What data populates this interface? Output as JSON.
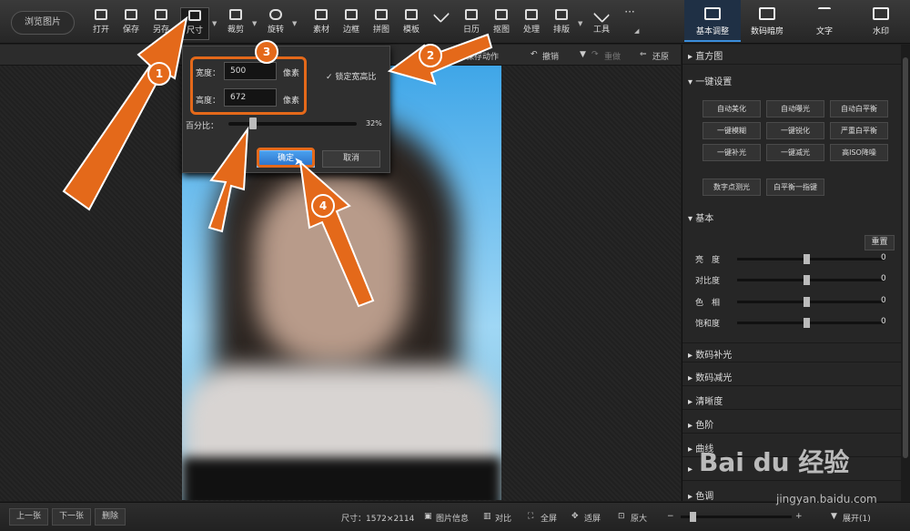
{
  "toolbar": {
    "browse_label": "浏览图片",
    "tools": [
      {
        "label": "打开",
        "icon": "open-icon"
      },
      {
        "label": "保存",
        "icon": "save-icon"
      },
      {
        "label": "另存",
        "icon": "save-as-icon"
      },
      {
        "label": "尺寸",
        "icon": "resize-icon"
      },
      {
        "label": "裁剪",
        "icon": "crop-icon"
      },
      {
        "label": "旋转",
        "icon": "rotate-icon"
      },
      {
        "label": "素材",
        "icon": "material-icon"
      },
      {
        "label": "边框",
        "icon": "frame-icon"
      },
      {
        "label": "拼图",
        "icon": "collage-icon"
      },
      {
        "label": "模板",
        "icon": "template-icon"
      },
      {
        "label": "",
        "icon": "brush-icon"
      },
      {
        "label": "日历",
        "icon": "calendar-icon"
      },
      {
        "label": "抠图",
        "icon": "cutout-icon"
      },
      {
        "label": "处理",
        "icon": "batch-icon"
      },
      {
        "label": "排版",
        "icon": "layout-icon"
      },
      {
        "label": "工具",
        "icon": "tools-icon"
      },
      {
        "label": "",
        "icon": "more-icon"
      }
    ]
  },
  "right_tabs": [
    {
      "label": "基本调整",
      "icon": "adjust-icon",
      "active": true
    },
    {
      "label": "数码暗房",
      "icon": "camera-icon"
    },
    {
      "label": "文字",
      "icon": "text-icon"
    },
    {
      "label": "水印",
      "icon": "watermark-icon"
    }
  ],
  "subbar": {
    "save_action": "保存动作",
    "undo": "撤销",
    "redo": "重做",
    "restore": "还原"
  },
  "resize_dialog": {
    "width_label": "宽度：",
    "width_value": "500",
    "height_label": "高度：",
    "height_value": "672",
    "unit": "像素",
    "lock_label": "锁定宽高比",
    "lock_checked": true,
    "percent_label": "百分比：",
    "percent_value": "32%",
    "percent": 0.32,
    "ok": "确定",
    "cancel": "取消"
  },
  "panel": {
    "histogram": "直方图",
    "one_click": "一键设置",
    "buttons": [
      "自动美化",
      "自动曝光",
      "自动白平衡",
      "一键模糊",
      "一键锐化",
      "严重白平衡",
      "一键补光",
      "一键减光",
      "高ISO降噪"
    ],
    "buttons2": [
      "数字点测光",
      "白平衡一指键"
    ],
    "basic": "基本",
    "reset": "重置",
    "sliders": [
      {
        "label": "亮　度",
        "value": "0"
      },
      {
        "label": "对比度",
        "value": "0"
      },
      {
        "label": "色　相",
        "value": "0"
      },
      {
        "label": "饱和度",
        "value": "0"
      }
    ],
    "sections": [
      "数码补光",
      "数码减光",
      "清晰度",
      "色阶",
      "曲线",
      "",
      "色调"
    ]
  },
  "bottombar": {
    "prev": "上一张",
    "next": "下一张",
    "delete": "删除",
    "size": "尺寸：1572×2114",
    "info": "图片信息",
    "compare": "对比",
    "fullscreen": "全屏",
    "fit": "适屏",
    "original": "原大",
    "expand": "展开(1)"
  },
  "annotations": [
    "1",
    "2",
    "3",
    "4"
  ],
  "watermark": {
    "logo": "Bai du 经验",
    "url": "jingyan.baidu.com"
  },
  "colors": {
    "accent": "#e4691a",
    "primary_button": "#3a8ddb"
  }
}
